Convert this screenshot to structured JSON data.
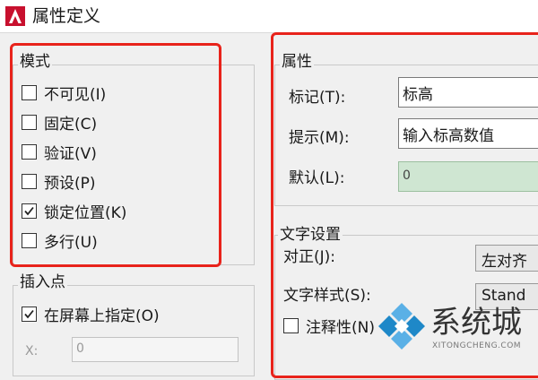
{
  "window": {
    "title": "属性定义"
  },
  "mode": {
    "label": "模式",
    "items": [
      {
        "label": "不可见(I)",
        "checked": false
      },
      {
        "label": "固定(C)",
        "checked": false
      },
      {
        "label": "验证(V)",
        "checked": false
      },
      {
        "label": "预设(P)",
        "checked": false
      },
      {
        "label": "锁定位置(K)",
        "checked": true
      },
      {
        "label": "多行(U)",
        "checked": false
      }
    ]
  },
  "insertion_point": {
    "label": "插入点",
    "specify_on_screen": {
      "label": "在屏幕上指定(O)",
      "checked": true
    },
    "x_label": "X:",
    "x_value": "0"
  },
  "attribute": {
    "label": "属性",
    "tag_label": "标记(T):",
    "tag_value": "标高",
    "prompt_label": "提示(M):",
    "prompt_value": "输入标高数值",
    "default_label": "默认(L):",
    "default_value": "0"
  },
  "text_settings": {
    "label": "文字设置",
    "justify_label": "对正(J):",
    "justify_value": "左对齐",
    "style_label": "文字样式(S):",
    "style_value": "Stand",
    "annotative_label": "注释性(N)",
    "annotative_checked": false
  },
  "watermark": {
    "text": "系统城",
    "url": "XITONGCHENG.COM"
  },
  "colors": {
    "highlight": "#e8231b",
    "accent": "#1e88c8"
  }
}
